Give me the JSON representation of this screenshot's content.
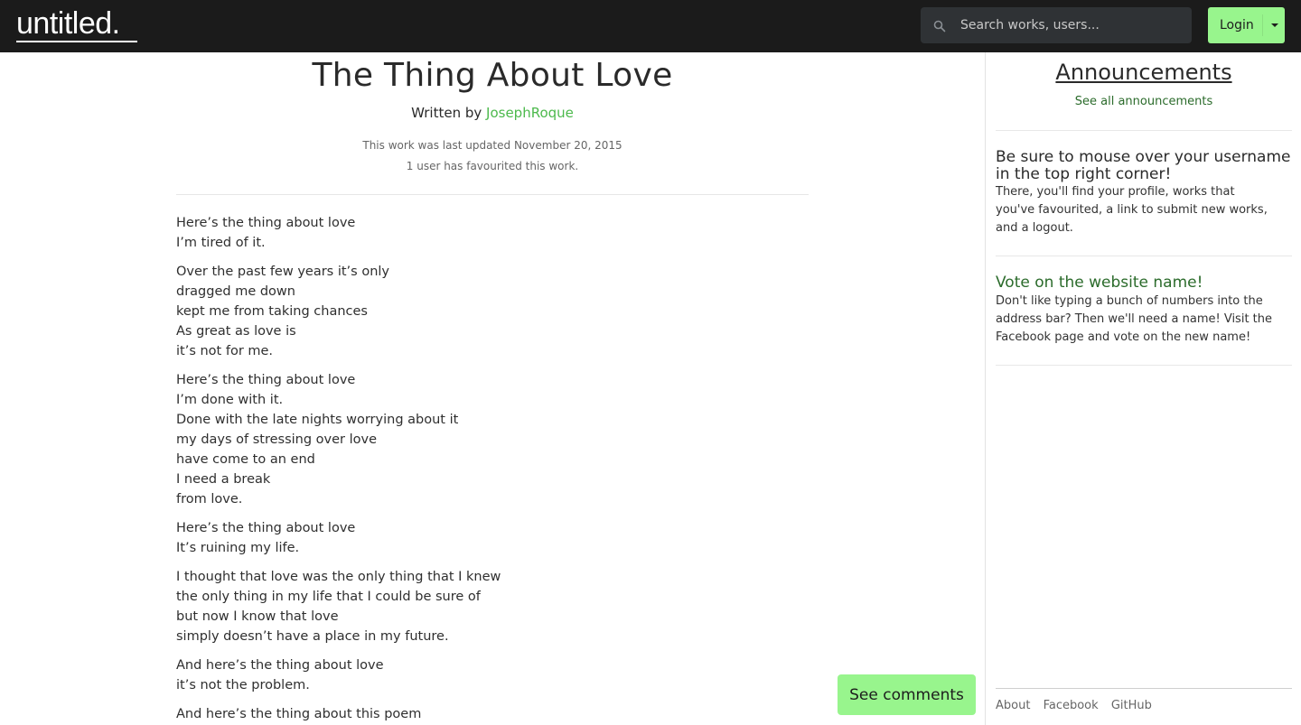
{
  "header": {
    "logo": "untitled.",
    "search_placeholder": "Search works, users...",
    "login_label": "Login"
  },
  "work": {
    "title": "The Thing About Love",
    "written_by": "Written by ",
    "author": "JosephRoque",
    "updated": "This work was last updated November 20, 2015",
    "favourites": "1 user has favourited this work.",
    "stanzas": [
      [
        "Here’s the thing about love",
        "I’m tired of it."
      ],
      [
        "Over the past few years it’s only",
        "dragged me down",
        "kept me from taking chances",
        "As great as love is",
        "it’s not for me."
      ],
      [
        "Here’s the thing about love",
        "I’m done with it.",
        "Done with the late nights worrying about it",
        "my days of stressing over love",
        "have come to an end",
        "I need a break",
        "from love."
      ],
      [
        "Here’s the thing about love",
        "It’s ruining my life."
      ],
      [
        "I thought that love was the only thing that I knew",
        "the only thing in my life that I could be sure of",
        "but now I know that love",
        "simply doesn’t have a place in my future."
      ],
      [
        "And here’s the thing about love",
        "it’s not the problem."
      ],
      [
        "And here’s the thing about this poem"
      ]
    ],
    "see_comments": "See comments"
  },
  "sidebar": {
    "title": "Announcements",
    "see_all": "See all announcements",
    "announcements": [
      {
        "heading": "Be sure to mouse over your username in the top right corner!",
        "body": "There, you'll find your profile, works that you've favourited, a link to submit new works, and a logout."
      },
      {
        "heading": "Vote on the website name!",
        "body": "Don't like typing a bunch of numbers into the address bar? Then we'll need a name! Visit the Facebook page and vote on the new name!"
      }
    ],
    "footer_links": [
      "About",
      "Facebook",
      "GitHub"
    ]
  },
  "colors": {
    "topbar": "#1b1b1b",
    "accent_green": "#98f58d",
    "author_green": "#4cb94c",
    "link_green": "#2b6b2b"
  }
}
